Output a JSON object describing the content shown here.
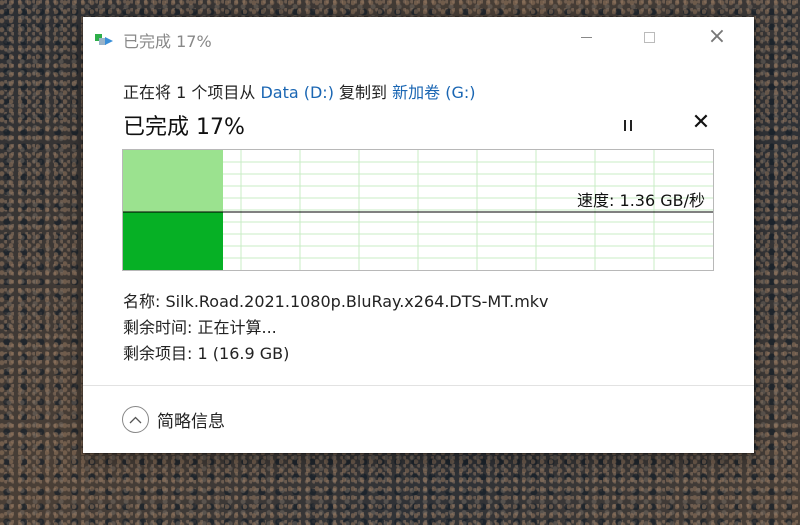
{
  "window": {
    "title": "已完成 17%",
    "icon": "copy-files-icon"
  },
  "controls": {
    "minimize_icon": "minimize-icon",
    "maximize_icon": "maximize-icon",
    "close_icon": "close-icon"
  },
  "copy": {
    "prefix": "正在将 1 个项目从 ",
    "source": "Data (D:)",
    "middle": " 复制到 ",
    "destination": "新加卷 (G:)",
    "status": "已完成 17%",
    "progress_fraction": 0.17
  },
  "actions": {
    "pause_icon": "pause-icon",
    "cancel_label": "✕"
  },
  "graph": {
    "speed_text": "速度: 1.36 GB/秒",
    "colors": {
      "fill": "#06b025",
      "fill_light": "#9be28f",
      "grid": "#c8ecc6",
      "line": "#000000"
    }
  },
  "details": {
    "name_label": "名称:",
    "name_value": "Silk.Road.2021.1080p.BluRay.x264.DTS-MT.mkv",
    "time_label": "剩余时间:",
    "time_value": "正在计算...",
    "items_label": "剩余项目:",
    "items_value": "1 (16.9 GB)"
  },
  "footer": {
    "less_details_label": "简略信息",
    "chevron_icon": "chevron-up-icon"
  }
}
